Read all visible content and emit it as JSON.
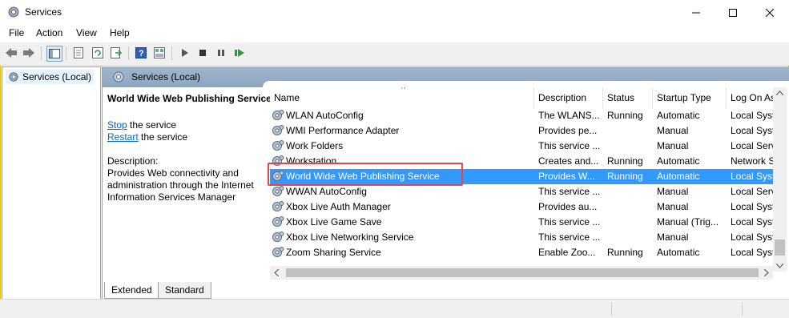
{
  "window": {
    "title": "Services",
    "minimize": "—",
    "maximize": "☐",
    "close": "✕"
  },
  "menu": [
    "File",
    "Action",
    "View",
    "Help"
  ],
  "toolbar_icons": [
    "back-icon",
    "forward-icon",
    "show-hide-tree-icon",
    "properties-icon",
    "refresh-icon",
    "export-list-icon",
    "help-icon",
    "console-view-icon",
    "start-service-icon",
    "stop-service-icon",
    "pause-service-icon",
    "restart-service-icon"
  ],
  "tree": {
    "item": "Services (Local)"
  },
  "pane": {
    "header": "Services (Local)",
    "service_title": "World Wide Web Publishing Service",
    "stop_link": "Stop",
    "stop_rest": " the service",
    "restart_link": "Restart",
    "restart_rest": " the service",
    "desc_label": "Description:",
    "desc_lines": [
      "Provides Web connectivity and",
      "administration through the Internet",
      "Information Services Manager"
    ]
  },
  "table": {
    "sort_indicator": "^",
    "columns": [
      "Name",
      "Description",
      "Status",
      "Startup Type",
      "Log On As"
    ],
    "rows": [
      {
        "name": "WLAN AutoConfig",
        "desc": "The WLANS...",
        "status": "Running",
        "startup": "Automatic",
        "logon": "Local Syst"
      },
      {
        "name": "WMI Performance Adapter",
        "desc": "Provides pe...",
        "status": "",
        "startup": "Manual",
        "logon": "Local Syst"
      },
      {
        "name": "Work Folders",
        "desc": "This service ...",
        "status": "",
        "startup": "Manual",
        "logon": "Local Serv"
      },
      {
        "name": "Workstation",
        "desc": "Creates and...",
        "status": "Running",
        "startup": "Automatic",
        "logon": "Network S"
      },
      {
        "name": "World Wide Web Publishing Service",
        "desc": "Provides W...",
        "status": "Running",
        "startup": "Automatic",
        "logon": "Local Syst",
        "selected": true
      },
      {
        "name": "WWAN AutoConfig",
        "desc": "This service ...",
        "status": "",
        "startup": "Manual",
        "logon": "Local Serv"
      },
      {
        "name": "Xbox Live Auth Manager",
        "desc": "Provides au...",
        "status": "",
        "startup": "Manual",
        "logon": "Local Syst"
      },
      {
        "name": "Xbox Live Game Save",
        "desc": "This service ...",
        "status": "",
        "startup": "Manual (Trig...",
        "logon": "Local Syst"
      },
      {
        "name": "Xbox Live Networking Service",
        "desc": "This service ...",
        "status": "",
        "startup": "Manual",
        "logon": "Local Syst"
      },
      {
        "name": "Zoom Sharing Service",
        "desc": "Enable Zoo...",
        "status": "Running",
        "startup": "Automatic",
        "logon": "Local Syst"
      }
    ]
  },
  "tabs": [
    "Extended",
    "Standard"
  ],
  "colors": {
    "selection": "#3399ff",
    "highlight_box": "#e0474c",
    "link": "#0066cc"
  }
}
